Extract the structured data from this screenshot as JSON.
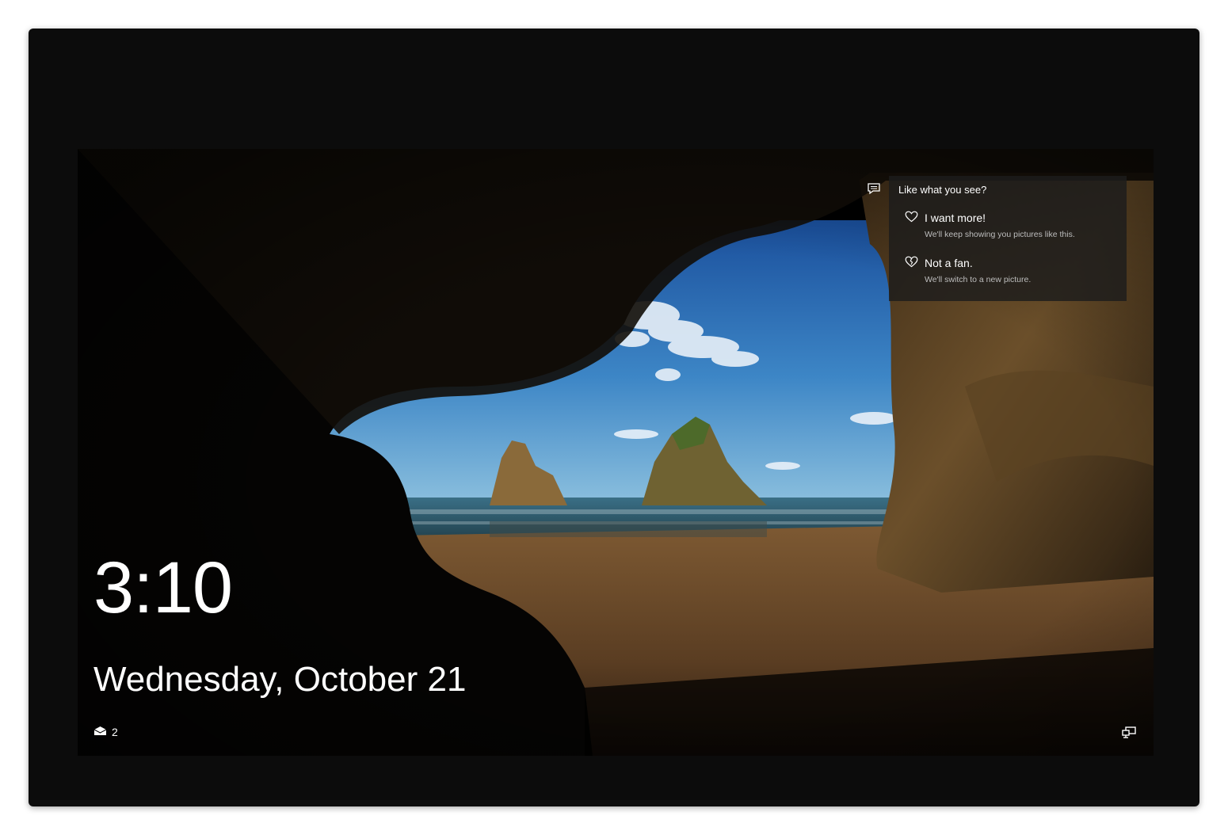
{
  "lockscreen": {
    "time": "3:10",
    "date": "Wednesday, October 21",
    "mail_count": "2"
  },
  "spotlight": {
    "title": "Like what you see?",
    "options": [
      {
        "label": "I want more!",
        "description": "We'll keep showing you pictures like this."
      },
      {
        "label": "Not a fan.",
        "description": "We'll switch to a new picture."
      }
    ]
  },
  "icons": {
    "mail": "mail-icon",
    "network": "network-icon",
    "spotlight": "feedback-icon",
    "like": "heart-icon",
    "dislike": "broken-heart-icon"
  }
}
